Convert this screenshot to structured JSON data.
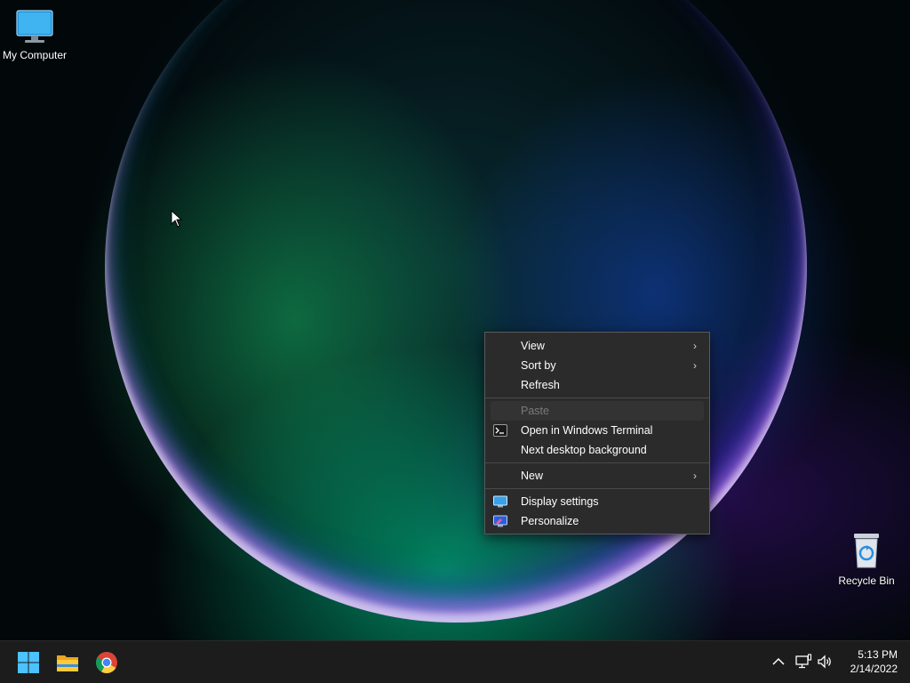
{
  "desktop": {
    "icons": [
      {
        "label": "My Computer",
        "icon": "monitor-icon"
      },
      {
        "label": "Recycle Bin",
        "icon": "recycle-bin-icon"
      }
    ]
  },
  "context_menu": {
    "items": [
      {
        "label": "View",
        "submenu": true
      },
      {
        "label": "Sort by",
        "submenu": true
      },
      {
        "label": "Refresh"
      },
      {
        "label": "Paste",
        "disabled": true
      },
      {
        "label": "Open in Windows Terminal",
        "icon": "terminal-icon"
      },
      {
        "label": "Next desktop background"
      },
      {
        "label": "New",
        "submenu": true
      },
      {
        "label": "Display settings",
        "icon": "display-icon"
      },
      {
        "label": "Personalize",
        "icon": "personalize-icon"
      }
    ],
    "submenu_arrow": "›"
  },
  "taskbar": {
    "apps": [
      {
        "name": "start",
        "icon": "windows-logo-icon"
      },
      {
        "name": "file-explorer",
        "icon": "folder-icon"
      },
      {
        "name": "chrome",
        "icon": "chrome-icon"
      }
    ],
    "tray": {
      "icons": [
        "chevron-up-icon",
        "network-icon",
        "volume-icon"
      ]
    },
    "clock": {
      "time": "5:13 PM",
      "date": "2/14/2022"
    }
  },
  "colors": {
    "menu_bg": "#2b2b2b",
    "taskbar_bg": "#1c1c1c",
    "accent": "#0078d4"
  }
}
